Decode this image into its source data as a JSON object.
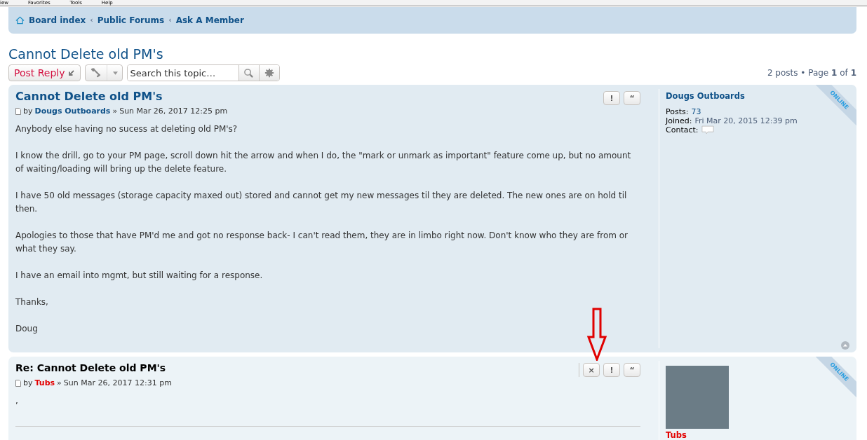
{
  "menu_bar": [
    "iew",
    "Favorites",
    "Tools",
    "Help"
  ],
  "breadcrumbs": [
    {
      "label": "Board index",
      "home": true
    },
    {
      "label": "Public Forums",
      "home": false
    },
    {
      "label": "Ask A Member",
      "home": false
    }
  ],
  "breadcrumb_separator": "‹",
  "topic_title": "Cannot Delete old PM's",
  "toolbar": {
    "post_reply": "Post Reply",
    "search": {
      "placeholder": "Search this topic…"
    }
  },
  "pagination": "2 posts • Page **1** of **1**",
  "posts": [
    {
      "kind": "first",
      "title": "Cannot Delete old PM's",
      "by": "by",
      "author": "Dougs Outboards",
      "color": "#105289",
      "separator": "»",
      "date": "Sun Mar 26, 2017 12:25 pm",
      "buttons": [
        "!",
        "“"
      ],
      "body": [
        "Anybody else having no sucess at deleting old PM's?",
        "I know the drill, go to your PM page, scroll down hit the arrow and when I do, the \"mark or unmark as important\" feature come up, but no amount of waiting/loading will bring up the delete feature.",
        "I have 50 old messages (storage capacity maxed out) stored and cannot get my new messages til they are deleted. The new ones are on hold til then.",
        "Apologies to those that have PM'd me and got no response back- I can't read them, they are in limbo right now. Don't know who they are from or what they say.",
        "I have an email into mgmt, but still waiting for a response.",
        "Thanks,",
        "Doug"
      ],
      "ribbon": "ONLINE",
      "avatar": false,
      "back_to_top": true,
      "profile_name": "Dougs Outboards",
      "profile": [
        {
          "kind": "text",
          "label": "Posts:",
          "value": "73"
        },
        {
          "kind": "text",
          "label": "Joined:",
          "value": "Fri Mar 20, 2015 12:39 pm"
        },
        {
          "kind": "contact",
          "label": "Contact:"
        }
      ],
      "annotated": false
    },
    {
      "kind": "reply",
      "title": "Re: Cannot Delete old PM's",
      "by": "by",
      "author": "Tubs",
      "color": "#e30000",
      "separator": "»",
      "date": "Sun Mar 26, 2017 12:31 pm",
      "buttons": [
        "×",
        "!",
        "“"
      ],
      "body": [
        ","
      ],
      "ribbon": "ONLINE",
      "avatar": true,
      "back_to_top": false,
      "profile_name": "Tubs",
      "annotated": true
    }
  ]
}
